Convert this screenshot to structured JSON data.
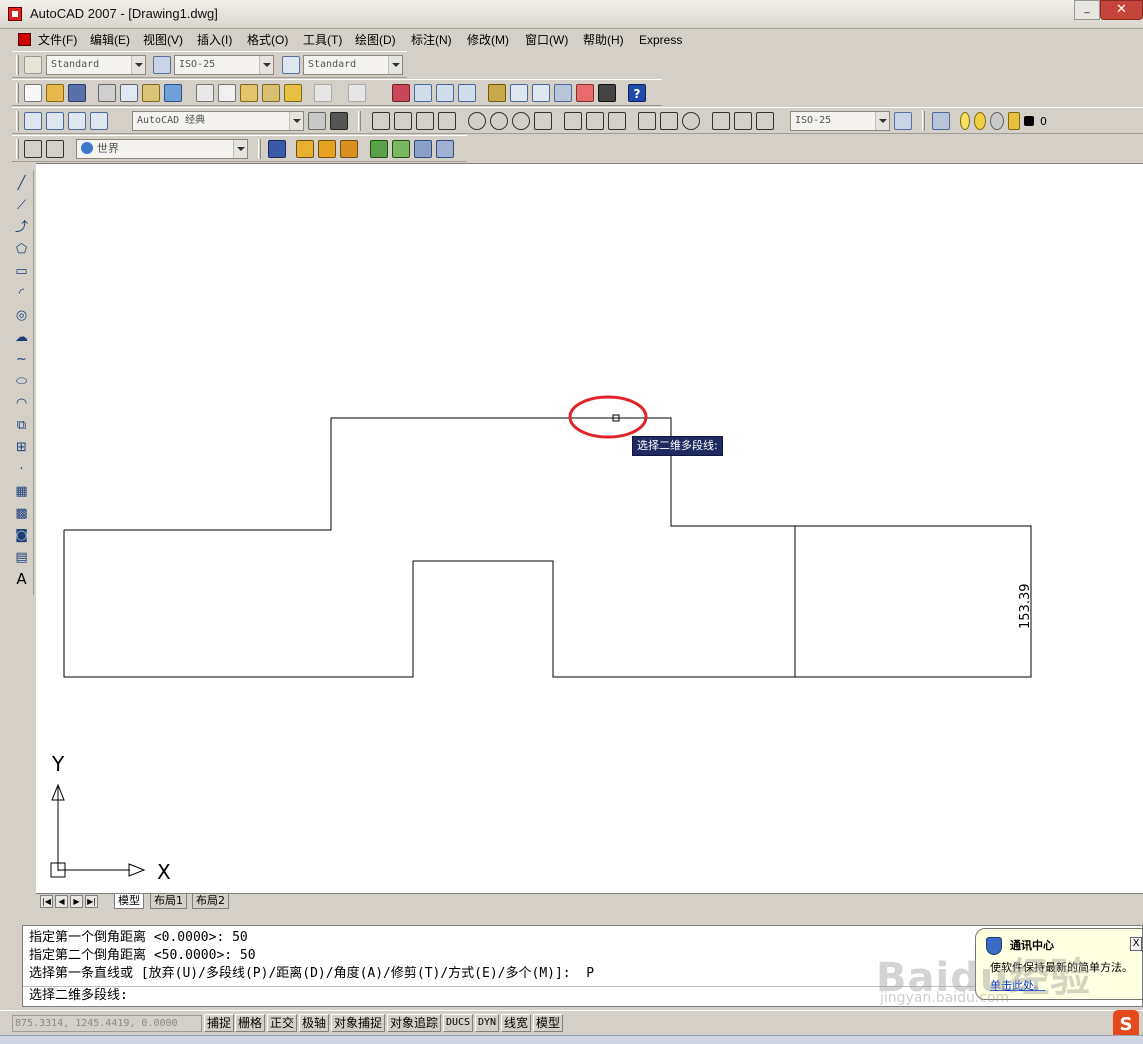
{
  "window": {
    "title": "AutoCAD 2007 - [Drawing1.dwg]",
    "close": "✕",
    "minimize": "_"
  },
  "menu": [
    "文件(F)",
    "编辑(E)",
    "视图(V)",
    "插入(I)",
    "格式(O)",
    "工具(T)",
    "绘图(D)",
    "标注(N)",
    "修改(M)",
    "窗口(W)",
    "帮助(H)",
    "Express"
  ],
  "toolbars": {
    "text_style": "Standard",
    "dim_style": "ISO-25",
    "table_style": "Standard",
    "workspace": "AutoCAD 经典",
    "dim_style_2": "ISO-25",
    "layer": "0",
    "ucs": "世界"
  },
  "canvas": {
    "dimension_label": "153.39",
    "tooltip": "选择二维多段线:",
    "axis_x": "X",
    "axis_y": "Y",
    "highlight_color": "#e0242a"
  },
  "tabs": {
    "model": "模型",
    "layout1": "布局1",
    "layout2": "布局2"
  },
  "command": {
    "lines": [
      "指定第一个倒角距离 <0.0000>: 50",
      "指定第二个倒角距离 <50.0000>: 50",
      "选择第一条直线或 [放弃(U)/多段线(P)/距离(D)/角度(A)/修剪(T)/方式(E)/多个(M)]:  P"
    ],
    "prompt": "选择二维多段线:"
  },
  "notification": {
    "title": "通讯中心",
    "body": "使软件保持最新的简单方法。",
    "link": "单击此处。",
    "close": "X"
  },
  "status": {
    "coords": "875.3314, 1245.4419, 0.0000",
    "buttons": [
      "捕捉",
      "栅格",
      "正交",
      "极轴",
      "对象捕捉",
      "对象追踪",
      "DUCS",
      "DYN",
      "线宽",
      "模型"
    ]
  },
  "watermark": {
    "main": "Baidu经验",
    "sub": "jingyan.baidu.com"
  }
}
